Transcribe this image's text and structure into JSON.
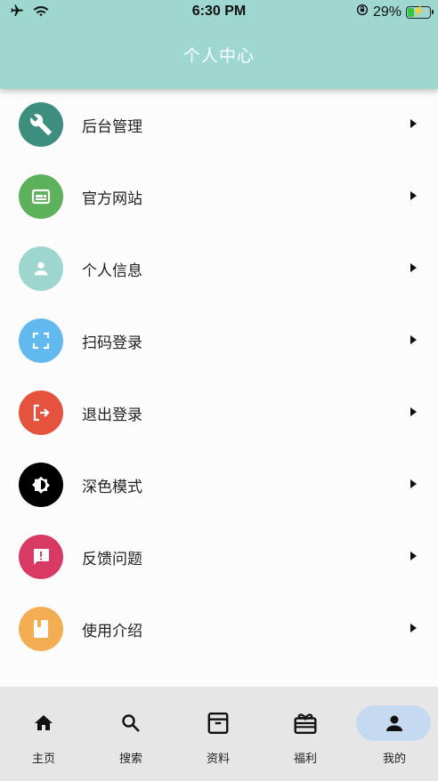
{
  "status_bar": {
    "time": "6:30 PM",
    "battery": "29%",
    "battery_level": 0.29
  },
  "header": {
    "title": "个人中心"
  },
  "menu": [
    {
      "label": "后台管理",
      "icon": "wrench-icon",
      "color": "#3e8e80"
    },
    {
      "label": "官方网站",
      "icon": "web-icon",
      "color": "#5cb15a"
    },
    {
      "label": "个人信息",
      "icon": "person-icon",
      "color": "#9cd6cf"
    },
    {
      "label": "扫码登录",
      "icon": "scan-icon",
      "color": "#62b9f0"
    },
    {
      "label": "退出登录",
      "icon": "logout-icon",
      "color": "#e5533f"
    },
    {
      "label": "深色模式",
      "icon": "brightness-icon",
      "color": "#000000"
    },
    {
      "label": "反馈问题",
      "icon": "feedback-icon",
      "color": "#d93a63"
    },
    {
      "label": "使用介绍",
      "icon": "book-icon",
      "color": "#f3ae54"
    }
  ],
  "tabs": [
    {
      "label": "主页",
      "icon": "home-icon"
    },
    {
      "label": "搜索",
      "icon": "search-icon"
    },
    {
      "label": "资料",
      "icon": "archive-icon"
    },
    {
      "label": "福利",
      "icon": "gift-icon"
    },
    {
      "label": "我的",
      "icon": "person-icon",
      "active": true
    }
  ],
  "colors": {
    "header": "#9dd7cf",
    "tab_active_pill": "#c5daf0",
    "tabbar": "#e6e6e6"
  }
}
